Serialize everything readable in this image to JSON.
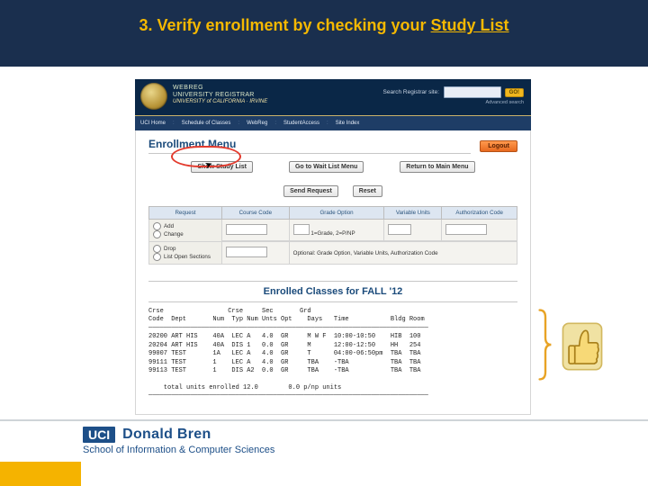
{
  "slide": {
    "title_prefix": "3. Verify enrollment by checking your ",
    "title_underlined": "Study List"
  },
  "banner": {
    "l1": "WEBREG",
    "l2": "UNIVERSITY REGISTRAR",
    "l3": "UNIVERSITY of CALIFORNIA · IRVINE",
    "search_label": "Search Registrar site:",
    "go": "GO!",
    "adv": "Advanced search"
  },
  "nav": {
    "items": [
      "UCI Home",
      "Schedule of Classes",
      "WebReg",
      "StudentAccess",
      "Site Index"
    ]
  },
  "enrollment_menu": {
    "heading": "Enrollment Menu",
    "logout": "Logout",
    "buttons": {
      "show_study_list": "Show Study List",
      "wait_list": "Go to Wait List Menu",
      "return_main": "Return to Main Menu",
      "send_request": "Send Request",
      "reset": "Reset"
    },
    "columns": [
      "Request",
      "Course Code",
      "Grade Option",
      "Variable Units",
      "Authorization Code"
    ],
    "requests": [
      "Add",
      "Change",
      "Drop",
      "List Open Sections"
    ],
    "hint1": "1=Grade, 2=P/NP",
    "hint2": "Optional: Grade Option, Variable Units, Authorization Code"
  },
  "study_list": {
    "title": "Enrolled Classes for FALL '12",
    "header": "Crse                 Crse     Sec       Grd\nCode  Dept       Num  Typ Num Unts Opt    Days   Time           Bldg Room",
    "rows": [
      "20200 ART HIS    40A  LEC A   4.0  GR     M W F  10:00-10:50    HIB  100",
      "20204 ART HIS    40A  DIS 1   0.0  GR     M      12:00-12:50    HH   254",
      "99007 TEST       1A   LEC A   4.0  GR     T      04:00-06:50pm  TBA  TBA",
      "99111 TEST       1    LEC A   4.0  GR     TBA    -TBA           TBA  TBA",
      "99113 TEST       1    DIS A2  0.0  GR     TBA    -TBA           TBA  TBA"
    ],
    "footer": "    total units enrolled 12.0        0.0 p/np units"
  },
  "school": {
    "uci": "UCI",
    "name": "Donald Bren",
    "dept": "School of Information & Computer Sciences"
  }
}
